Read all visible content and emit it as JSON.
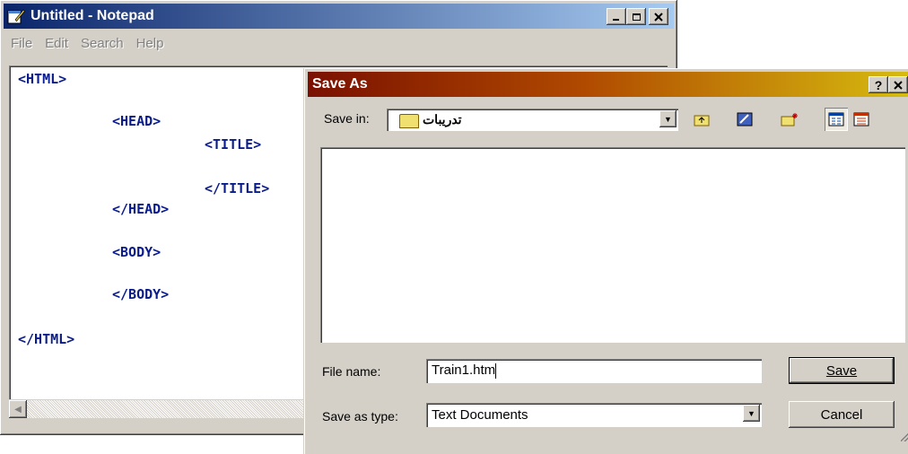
{
  "notepad": {
    "title": "Untitled - Notepad",
    "menu": [
      "File",
      "Edit",
      "Search",
      "Help"
    ],
    "caption_buttons": [
      "minimize-icon",
      "maximize-icon",
      "close-icon"
    ],
    "lines": [
      "<HTML>",
      "<HEAD>",
      "<TITLE>",
      "</TITLE>",
      "</HEAD>",
      "<BODY>",
      "</BODY>",
      "</HTML>"
    ]
  },
  "dialog": {
    "title": "Save As",
    "caption_buttons": [
      "help-icon",
      "close-icon"
    ],
    "save_in_label": "Save in:",
    "save_in_value": "تدريبات",
    "toolbar_icons": [
      "up-folder-icon",
      "desktop-icon",
      "new-folder-icon",
      "list-view-icon",
      "details-view-icon"
    ],
    "file_name_label": "File name:",
    "file_name_value": "Train1.htm",
    "save_as_type_label": "Save as type:",
    "save_as_type_value": "Text Documents",
    "save_button": "Save",
    "cancel_button": "Cancel"
  },
  "colors": {
    "notepad_titlebar": "#0a246a",
    "dialog_titlebar": "#7a1000",
    "code_text": "#0a1b8a",
    "face": "#d4d0c8"
  }
}
